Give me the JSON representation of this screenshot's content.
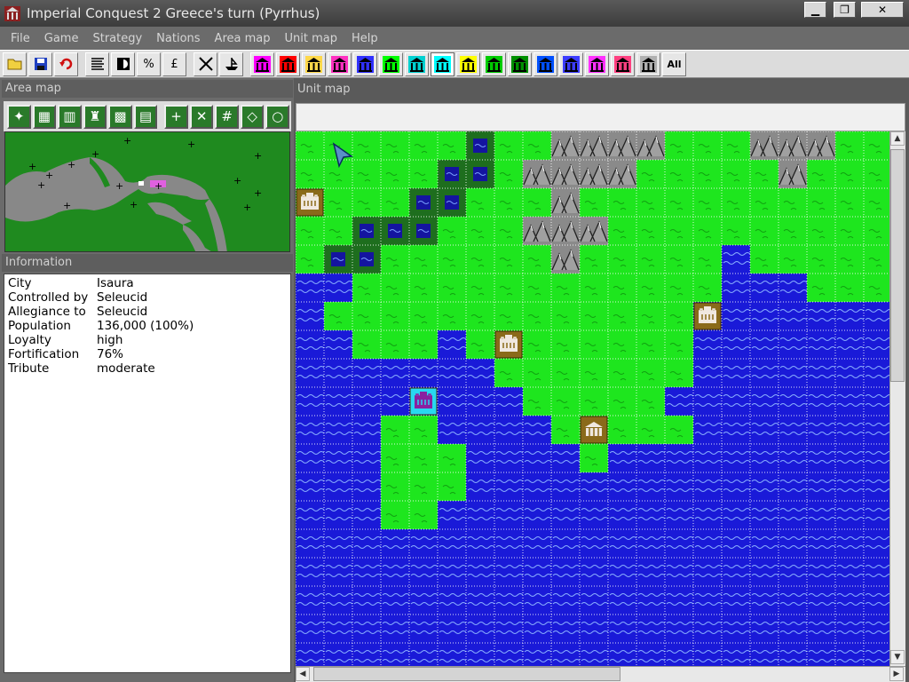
{
  "window": {
    "title": "Imperial Conquest 2    Greece's turn   (Pyrrhus)",
    "minimize": "▁",
    "maximize": "❐",
    "close": "✕"
  },
  "menu": [
    "File",
    "Game",
    "Strategy",
    "Nations",
    "Area map",
    "Unit map",
    "Help"
  ],
  "toolbar": {
    "percent": "%",
    "pound": "£",
    "all": "All",
    "nation_colors": [
      "#ff00ff",
      "#ff0000",
      "#ffd84a",
      "#ff30c0",
      "#3030ff",
      "#00ff00",
      "#00d0d0",
      "#00ffff",
      "#ffff00",
      "#00cc00",
      "#009000",
      "#0050ff",
      "#3c3cff",
      "#ff30ff",
      "#ff4080",
      "#b0b0b0"
    ],
    "selected_index": 7
  },
  "area_map": {
    "label": "Area map",
    "tool_symbols": [
      "✦",
      "▦",
      "▥",
      "♜",
      "▩",
      "▤",
      "+",
      "✕",
      "#",
      "◇",
      "○"
    ]
  },
  "information": {
    "label": "Information",
    "rows": [
      {
        "key": "City",
        "value": "Isaura"
      },
      {
        "key": "Controlled by",
        "value": "Seleucid"
      },
      {
        "key": "Allegiance to",
        "value": "Seleucid"
      },
      {
        "key": "Population",
        "value": "136,000   (100%)"
      },
      {
        "key": "Loyalty",
        "value": "high"
      },
      {
        "key": "Fortification",
        "value": "76%"
      },
      {
        "key": "Tribute",
        "value": "moderate"
      }
    ]
  },
  "unit_map": {
    "label": "Unit map",
    "columns": 21,
    "rows": 19,
    "colors": {
      "grass": "#1ee61e",
      "sea": "#1a1ad8",
      "mountain": "#8a8a8a",
      "river": "#1e6e1e",
      "seleucid": "#8a6a1a",
      "greek": "#28d8f0"
    },
    "terrain": [
      "GGGGGGRGGMMMMGGGMMMGG",
      "GGGGGRRGMMMMGGGGGMGGG",
      "GGGGRRGGGMGGGGGGGGGGG",
      "GGRRRGGGMMMGGGGGGGGGG",
      "GRRGGGGGGMGGGGGSGGGGG",
      "SSGGGGGGGGGGGGGSSSGGG",
      "SGGGGGGGGGGGGGSSSSSSS",
      "SSGGGSGGGGGGGGSSSSSSS",
      "SSSSSSSGGGGGGGSSSSSSS",
      "SSSSSSSSGGGGGSSSSSSSS",
      "SSSGGSSSSGGGGGSSSSSSS",
      "SSSGGGSSSSGSSSSSSSSSS",
      "SSSGGGSSSSSSSSSSSSSSS",
      "SSSGGSSSSSSSSSSSSSSSS",
      "SSSSSSSSSSSSSSSSSSSSS",
      "SSSSSSSSSSSSSSSSSSSSS",
      "SSSSSSSSSSSSSSSSSSSSS",
      "SSSSSSSSSSSSSSSSSSSSS",
      "SSSSSSSSSSSSSSSSSSSSS"
    ],
    "cities": [
      {
        "col": 0,
        "row": 2,
        "owner": "seleucid",
        "kind": "fort"
      },
      {
        "col": 14,
        "row": 6,
        "owner": "seleucid",
        "kind": "fort"
      },
      {
        "col": 7,
        "row": 7,
        "owner": "seleucid",
        "kind": "fort"
      },
      {
        "col": 4,
        "row": 9,
        "owner": "greek",
        "kind": "fort"
      },
      {
        "col": 10,
        "row": 10,
        "owner": "seleucid",
        "kind": "temple"
      }
    ]
  }
}
